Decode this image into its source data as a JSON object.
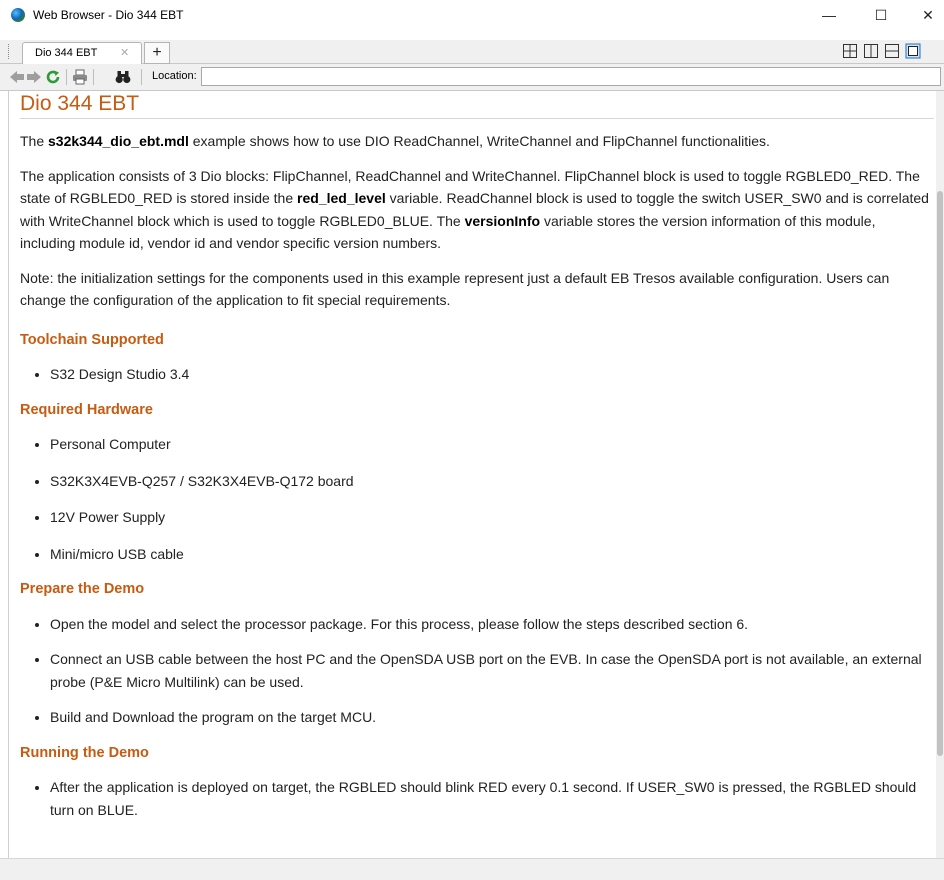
{
  "window": {
    "title": "Web Browser - Dio 344 EBT",
    "minimize": "—",
    "maximize": "☐",
    "close": "✕"
  },
  "tabs": {
    "active_label": "Dio 344 EBT",
    "close_glyph": "✕",
    "add_glyph": "+"
  },
  "toolbar": {
    "location_label": "Location:",
    "location_value": ""
  },
  "doc": {
    "title": "Dio 344 EBT",
    "intro": {
      "pre": "The ",
      "bold": "s32k344_dio_ebt.mdl",
      "post": " example shows how to use DIO ReadChannel, WriteChannel and FlipChannel functionalities."
    },
    "desc": {
      "part1": "The application consists of 3 Dio blocks: FlipChannel, ReadChannel and WriteChannel. FlipChannel block is used to toggle RGBLED0_RED. The state of RGBLED0_RED is stored inside the ",
      "bold1": "red_led_level",
      "part2": " variable. ReadChannel block is used to toggle the switch USER_SW0 and is correlated with WriteChannel block which is used to toggle RGBLED0_BLUE. The ",
      "bold2": "versionInfo",
      "part3": " variable stores the version information of this module, including module id, vendor id and vendor specific version numbers."
    },
    "note": "Note: the initialization settings for the components used in this example represent just a default EB Tresos available configuration. Users can change the configuration of the application to fit special requirements.",
    "sections": {
      "toolchain": {
        "heading": "Toolchain Supported",
        "items": [
          "S32 Design Studio 3.4"
        ]
      },
      "hardware": {
        "heading": "Required Hardware",
        "items": [
          "Personal Computer",
          "S32K3X4EVB-Q257 / S32K3X4EVB-Q172 board",
          "12V Power Supply",
          "Mini/micro USB cable"
        ]
      },
      "prepare": {
        "heading": "Prepare the Demo",
        "items": [
          "Open the model and select the processor package. For this process, please follow the steps described section 6.",
          "Connect an USB cable between the host PC and the OpenSDA USB port on the EVB. In case the OpenSDA port is not available, an external probe (P&E Micro Multilink) can be used.",
          "Build and Download the program on the target MCU."
        ]
      },
      "running": {
        "heading": "Running the Demo",
        "items": [
          "After the application is deployed on target, the RGBLED should blink RED every 0.1 second. If USER_SW0 is pressed, the RGBLED should turn on BLUE."
        ]
      }
    }
  },
  "colors": {
    "heading": "#c75b12",
    "text": "#222222",
    "chrome": "#f0f0f0"
  }
}
